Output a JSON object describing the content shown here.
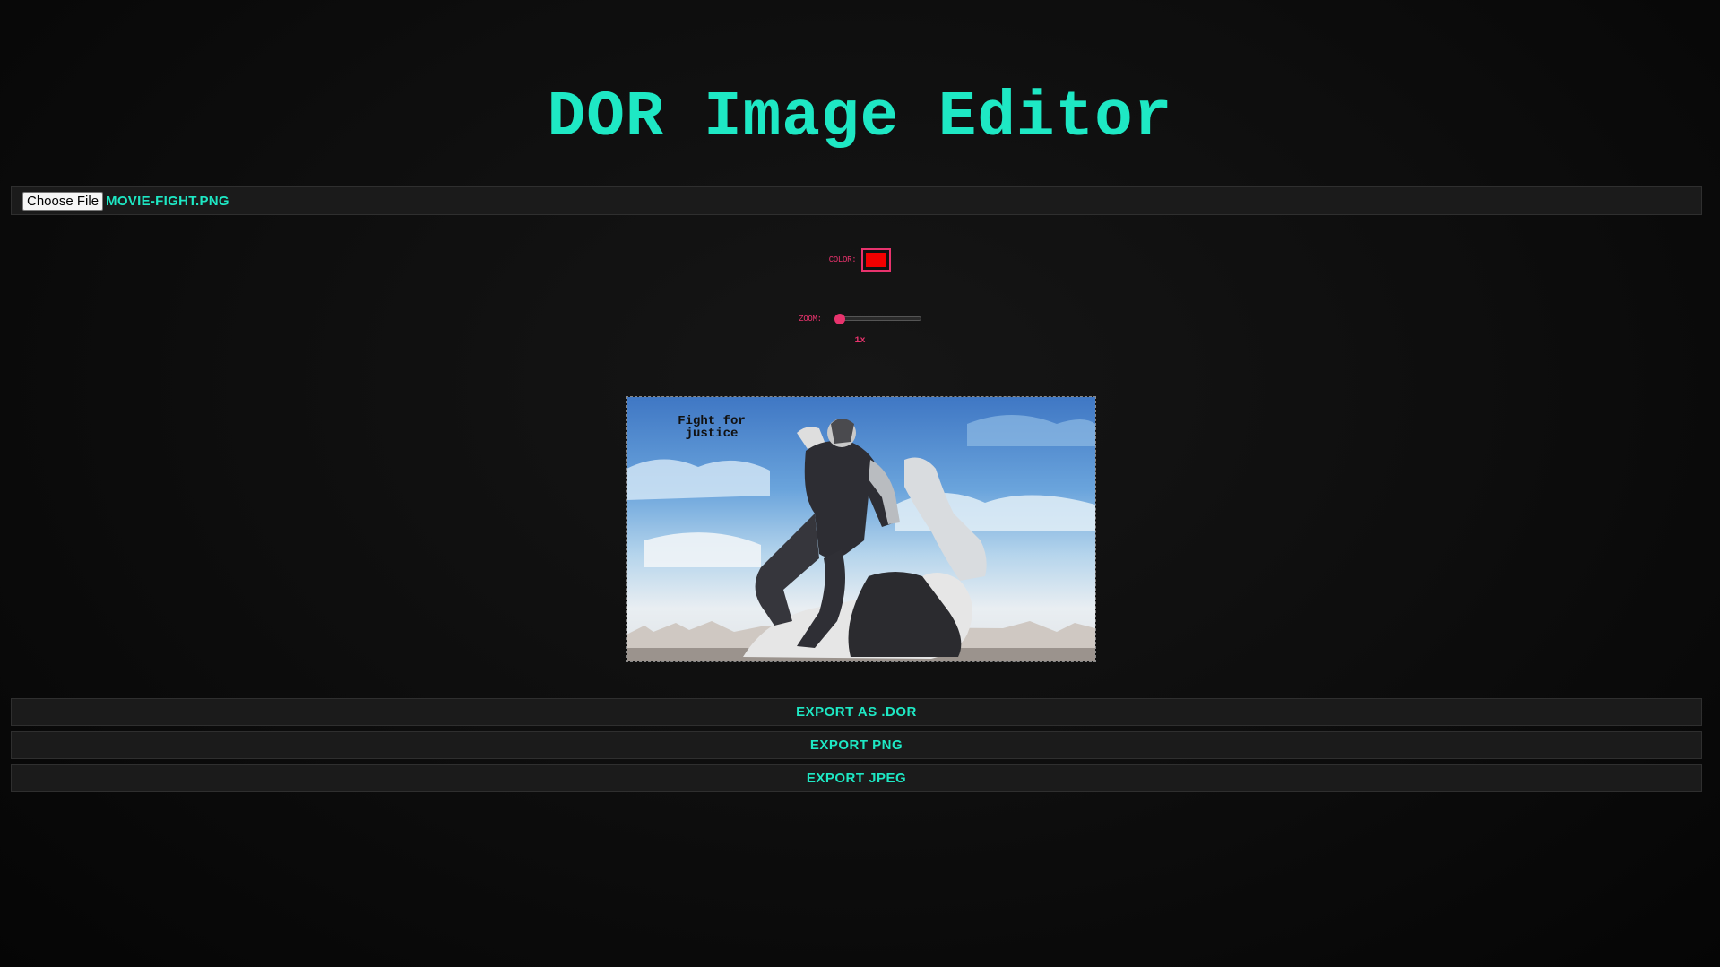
{
  "app": {
    "title": "DOR Image Editor"
  },
  "file_input": {
    "button_label": "Choose File",
    "file_name": "MOVIE-FIGHT.PNG"
  },
  "color_picker": {
    "label": "COLOR:",
    "value": "#f20000"
  },
  "zoom": {
    "label": "ZOOM:",
    "value_text": "1x",
    "level_fraction": 0.0
  },
  "canvas": {
    "caption_line1": "Fight for",
    "caption_line2": "justice"
  },
  "export": {
    "dor_label": "EXPORT AS .DOR",
    "png_label": "EXPORT PNG",
    "jpeg_label": "EXPORT JPEG"
  },
  "colors": {
    "accent": "#1ee8c4",
    "secondary_accent": "#e8336d",
    "background": "#0d0d0d",
    "panel": "#1b1b1b"
  }
}
